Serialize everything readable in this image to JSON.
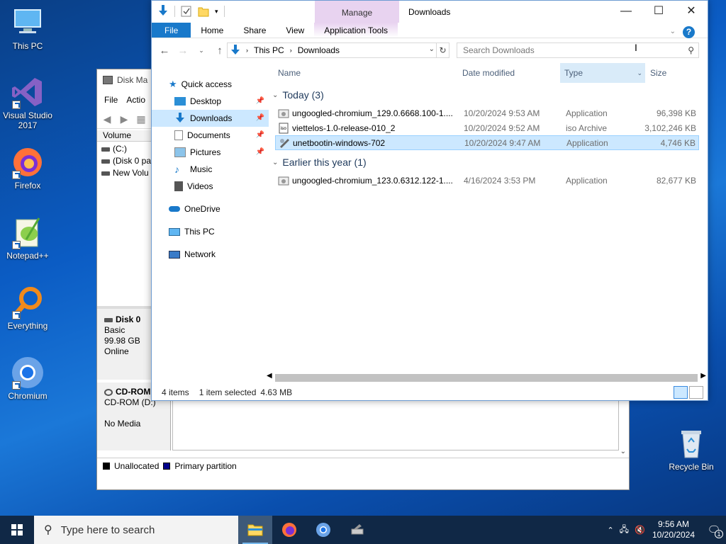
{
  "desktop": {
    "icons": [
      {
        "label": "This PC"
      },
      {
        "label": "Visual Studio 2017"
      },
      {
        "label": "Firefox"
      },
      {
        "label": "Notepad++"
      },
      {
        "label": "Everything"
      },
      {
        "label": "Chromium"
      },
      {
        "label": "Recycle Bin"
      }
    ]
  },
  "diskmgmt": {
    "title": "Disk Ma",
    "menu": [
      "File",
      "Actio"
    ],
    "volume_header": "Volume",
    "volumes": [
      "(C:)",
      "(Disk 0 par",
      "New Volu"
    ],
    "disk0": {
      "name": "Disk 0",
      "type": "Basic",
      "size": "99.98 GB",
      "status": "Online"
    },
    "cdrom": {
      "name": "CD-ROM",
      "drive": "CD-ROM (D:)",
      "media": "No Media"
    },
    "legend": {
      "unallocated": "Unallocated",
      "primary": "Primary partition"
    }
  },
  "explorer": {
    "title": "Downloads",
    "manage_tab": "Manage",
    "ribbon_tabs": {
      "file": "File",
      "home": "Home",
      "share": "Share",
      "view": "View",
      "app_tools": "Application Tools"
    },
    "breadcrumb": [
      "This PC",
      "Downloads"
    ],
    "search_placeholder": "Search Downloads",
    "nav": {
      "quick_access": "Quick access",
      "desktop": "Desktop",
      "downloads": "Downloads",
      "documents": "Documents",
      "pictures": "Pictures",
      "music": "Music",
      "videos": "Videos",
      "onedrive": "OneDrive",
      "this_pc": "This PC",
      "network": "Network"
    },
    "columns": {
      "name": "Name",
      "date": "Date modified",
      "type": "Type",
      "size": "Size"
    },
    "groups": [
      {
        "label": "Today (3)",
        "files": [
          {
            "name": "ungoogled-chromium_129.0.6668.100-1....",
            "date": "10/20/2024 9:53 AM",
            "type": "Application",
            "size": "96,398 KB"
          },
          {
            "name": "viettelos-1.0-release-010_2",
            "date": "10/20/2024 9:52 AM",
            "type": "iso Archive",
            "size": "3,102,246 KB"
          },
          {
            "name": "unetbootin-windows-702",
            "date": "10/20/2024 9:47 AM",
            "type": "Application",
            "size": "4,746 KB"
          }
        ]
      },
      {
        "label": "Earlier this year (1)",
        "files": [
          {
            "name": "ungoogled-chromium_123.0.6312.122-1....",
            "date": "4/16/2024 3:53 PM",
            "type": "Application",
            "size": "82,677 KB"
          }
        ]
      }
    ],
    "status": {
      "count": "4 items",
      "selected": "1 item selected",
      "size": "4.63 MB"
    }
  },
  "taskbar": {
    "search_placeholder": "Type here to search",
    "time": "9:56 AM",
    "date": "10/20/2024",
    "notification_count": "1"
  }
}
